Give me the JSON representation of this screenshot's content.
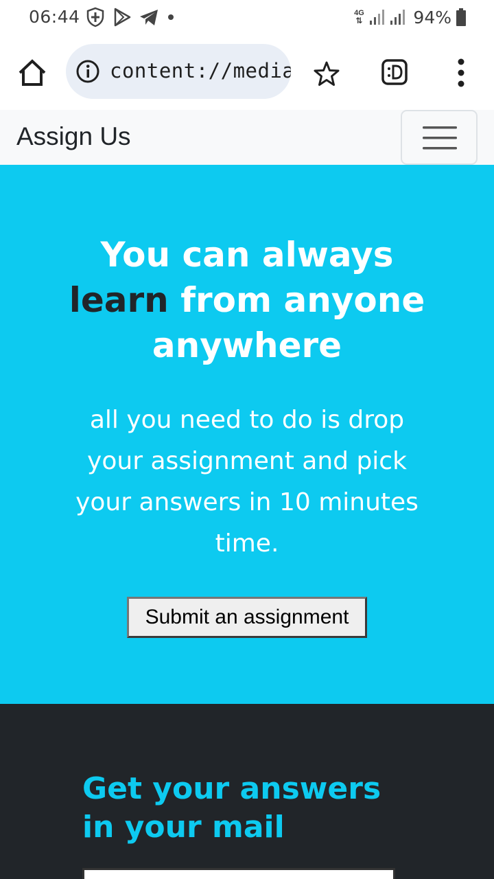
{
  "status_bar": {
    "time": "06:44",
    "network_type": "4G",
    "battery": "94%"
  },
  "browser": {
    "url": "content://media"
  },
  "navbar": {
    "brand": "Assign Us"
  },
  "hero": {
    "title_line1": "You can always",
    "title_dark_word": "learn",
    "title_rest": "from anyone anywhere",
    "text": "all you need to do is drop your assignment and pick your answers in 10 minutes time.",
    "button_label": "Submit an assignment"
  },
  "footer": {
    "title": "Get your answers in your mail"
  },
  "colors": {
    "accent_cyan": "#0dcaf0",
    "dark": "#212529",
    "navbar_bg": "#f8f9fa"
  }
}
